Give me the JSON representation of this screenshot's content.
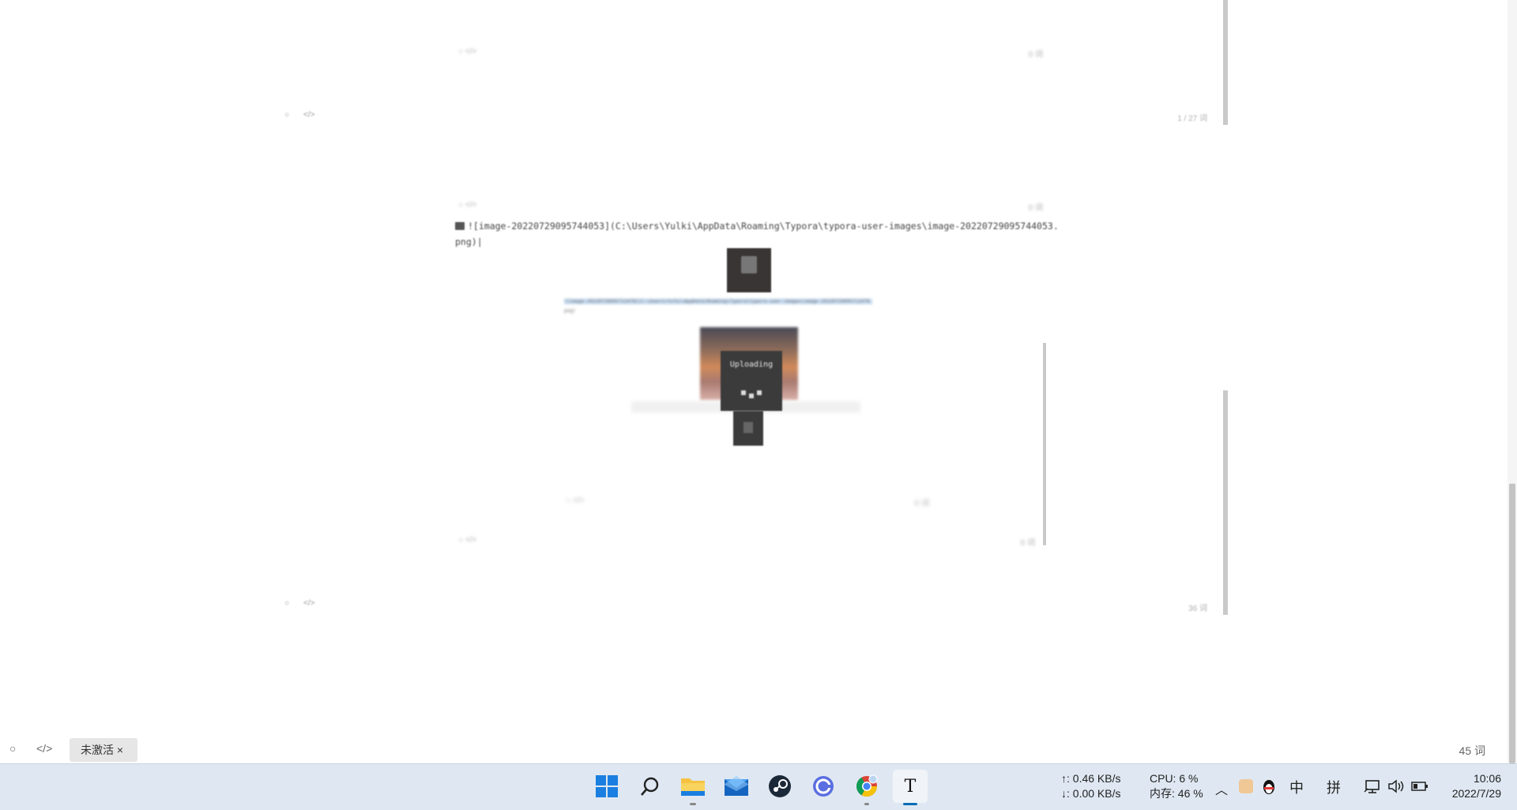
{
  "editor": {
    "top_panel": {
      "word_count": "1 / 27 词"
    },
    "markdown_line": {
      "text": "![image-20220729095744053](C:\\Users\\Yulki\\AppData\\Roaming\\Typora\\typora-user-images\\image-20220729095744053.",
      "text2": "png)|"
    },
    "inner_panel": {
      "path_text": "![image-20220729095712478](C:\\Users\\Yulki\\AppData\\Roaming\\Typora\\typora-user-images\\image-20220729095712478.",
      "path_text2": "png)"
    },
    "upload_dialog": {
      "label": "Uploading"
    },
    "bottom_panel": {
      "word_count": "36 词"
    }
  },
  "status_bar": {
    "unactivated_label": "未激活 ×",
    "word_count": "45 词"
  },
  "taskbar": {
    "apps": [
      {
        "name": "windows-start",
        "icon": "windows-logo-icon"
      },
      {
        "name": "search",
        "icon": "search-icon"
      },
      {
        "name": "file-explorer",
        "icon": "folder-icon"
      },
      {
        "name": "mail",
        "icon": "mail-icon"
      },
      {
        "name": "steam",
        "icon": "steam-icon"
      },
      {
        "name": "browser",
        "icon": "circle-app-icon"
      },
      {
        "name": "chrome",
        "icon": "chrome-icon"
      },
      {
        "name": "typora",
        "icon": "typora-icon",
        "glyph": "T"
      }
    ],
    "network": {
      "upload": "↑: 0.46 KB/s",
      "download": "↓: 0.00 KB/s"
    },
    "system": {
      "cpu": "CPU: 6 %",
      "memory": "内存: 46 %"
    },
    "tray": {
      "chevron": "^",
      "ime_lang": "中",
      "ime_mode": "拼"
    },
    "clock": {
      "time": "10:06",
      "date": "2022/7/29"
    },
    "colors": {
      "taskbar_bg": "#dfe8f2",
      "accent": "#0a6bb5"
    }
  }
}
